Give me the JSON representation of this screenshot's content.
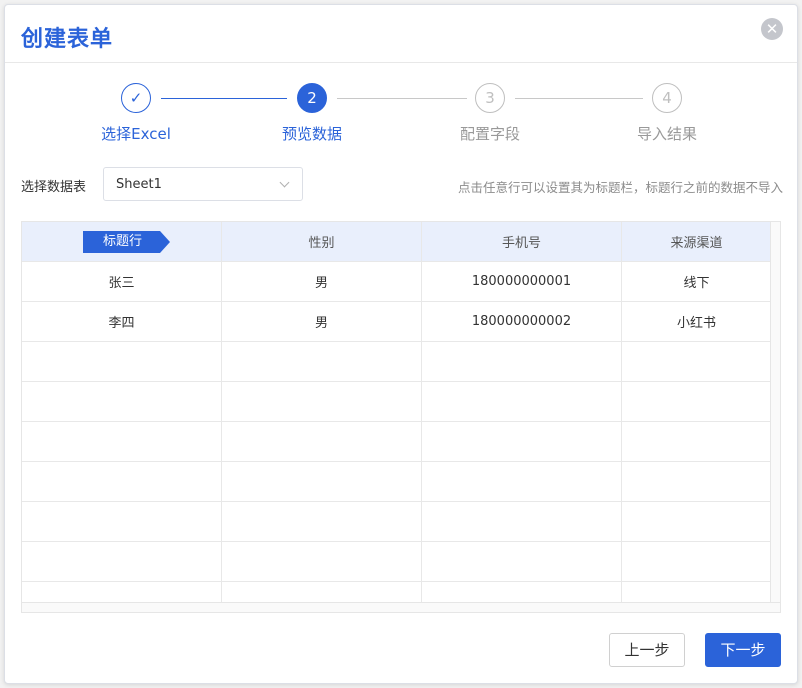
{
  "dialog": {
    "title": "创建表单",
    "close_glyph": "✕"
  },
  "steps": [
    {
      "label": "选择Excel",
      "marker": "✓",
      "state": "done"
    },
    {
      "label": "预览数据",
      "marker": "2",
      "state": "active"
    },
    {
      "label": "配置字段",
      "marker": "3",
      "state": "pending"
    },
    {
      "label": "导入结果",
      "marker": "4",
      "state": "pending"
    }
  ],
  "sheet_select": {
    "label": "选择数据表",
    "value": "Sheet1"
  },
  "hint": "点击任意行可以设置其为标题栏，标题行之前的数据不导入",
  "table": {
    "header_tag": "标题行",
    "columns": [
      "性别",
      "手机号",
      "来源渠道"
    ],
    "rows": [
      [
        "张三",
        "男",
        "180000000001",
        "线下"
      ],
      [
        "李四",
        "男",
        "180000000002",
        "小红书"
      ]
    ]
  },
  "footer": {
    "prev_label": "上一步",
    "next_label": "下一步"
  },
  "colors": {
    "accent": "#2b63d9",
    "header_bg": "#e9effc"
  }
}
